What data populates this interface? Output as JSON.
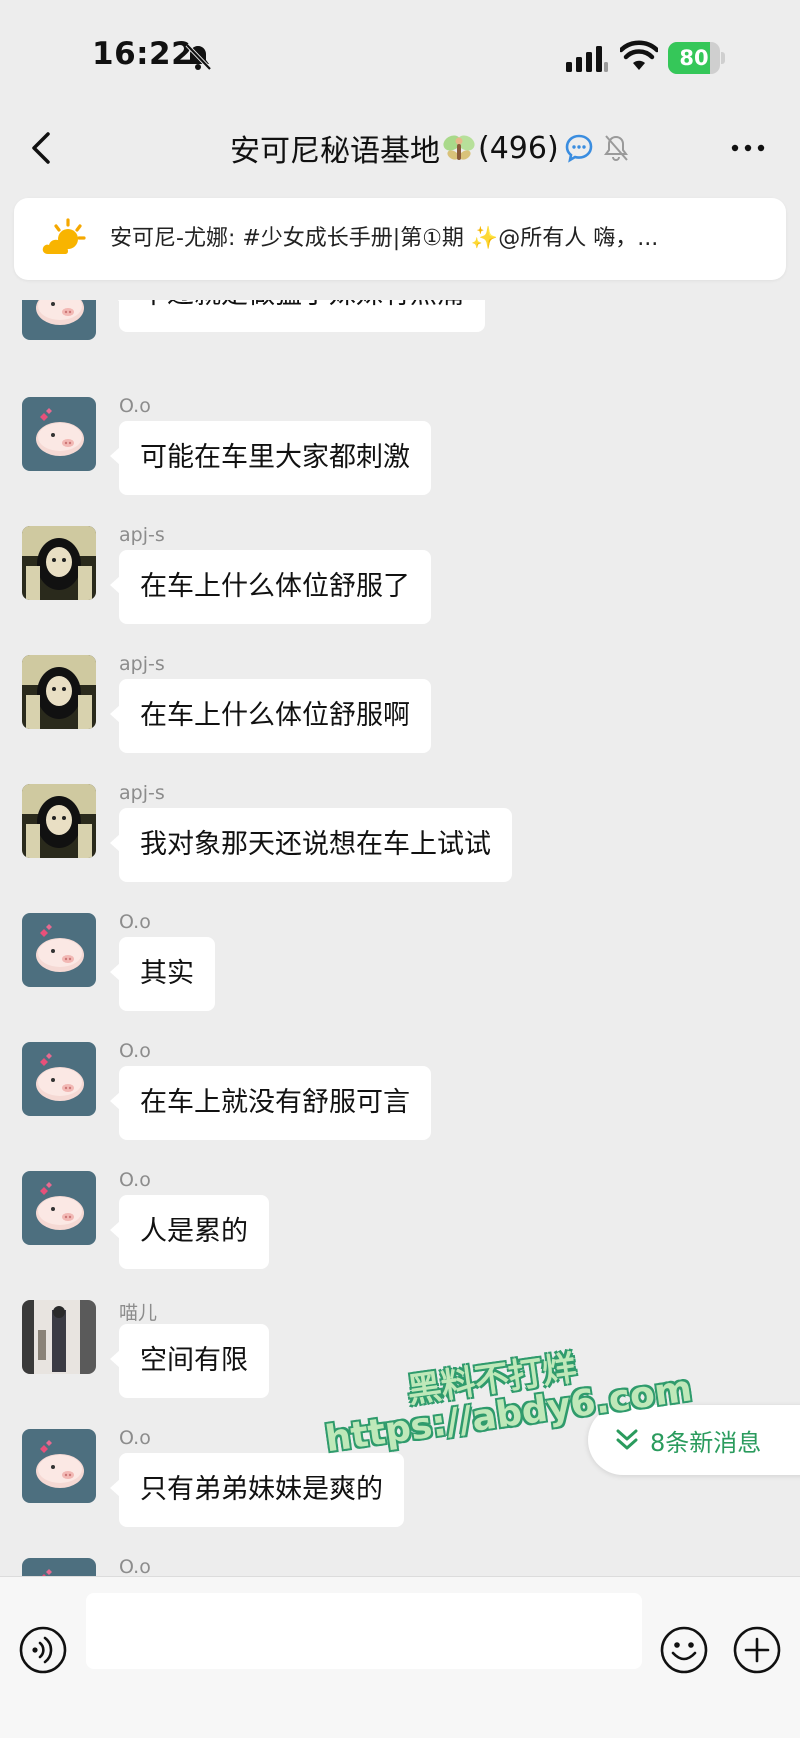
{
  "status_bar": {
    "time": "16:22",
    "battery_level": 80,
    "battery_label": "80"
  },
  "header": {
    "title": "安可尼秘语基地",
    "member_count": "(496)"
  },
  "pinned": {
    "text": "安可尼-尤娜: #少女成长手册|第①期 ✨@所有人  嗨，..."
  },
  "messages": [
    {
      "sender": "",
      "avatar": "pig",
      "text": "不过就是做猛了妹妹有点痛"
    },
    {
      "sender": "O.o",
      "avatar": "pig",
      "text": "可能在车里大家都刺激"
    },
    {
      "sender": "apj-s",
      "avatar": "girl",
      "text": "在车上什么体位舒服了"
    },
    {
      "sender": "apj-s",
      "avatar": "girl",
      "text": "在车上什么体位舒服啊"
    },
    {
      "sender": "apj-s",
      "avatar": "girl",
      "text": "我对象那天还说想在车上试试"
    },
    {
      "sender": "O.o",
      "avatar": "pig",
      "text": "其实"
    },
    {
      "sender": "O.o",
      "avatar": "pig",
      "text": "在车上就没有舒服可言"
    },
    {
      "sender": "O.o",
      "avatar": "pig",
      "text": "人是累的"
    },
    {
      "sender": "喵儿",
      "avatar": "photo",
      "text": "空间有限"
    },
    {
      "sender": "O.o",
      "avatar": "pig",
      "text": "只有弟弟妹妹是爽的"
    },
    {
      "sender": "O.o",
      "avatar": "pig",
      "text": ""
    }
  ],
  "new_messages": {
    "label": "8条新消息"
  },
  "watermark": {
    "line1": "黑料不打烊",
    "line2": "https://abdy6.com"
  },
  "input": {
    "value": ""
  },
  "colors": {
    "accent_green": "#2a9b5d",
    "battery_green": "#35c759",
    "background": "#ededed"
  }
}
